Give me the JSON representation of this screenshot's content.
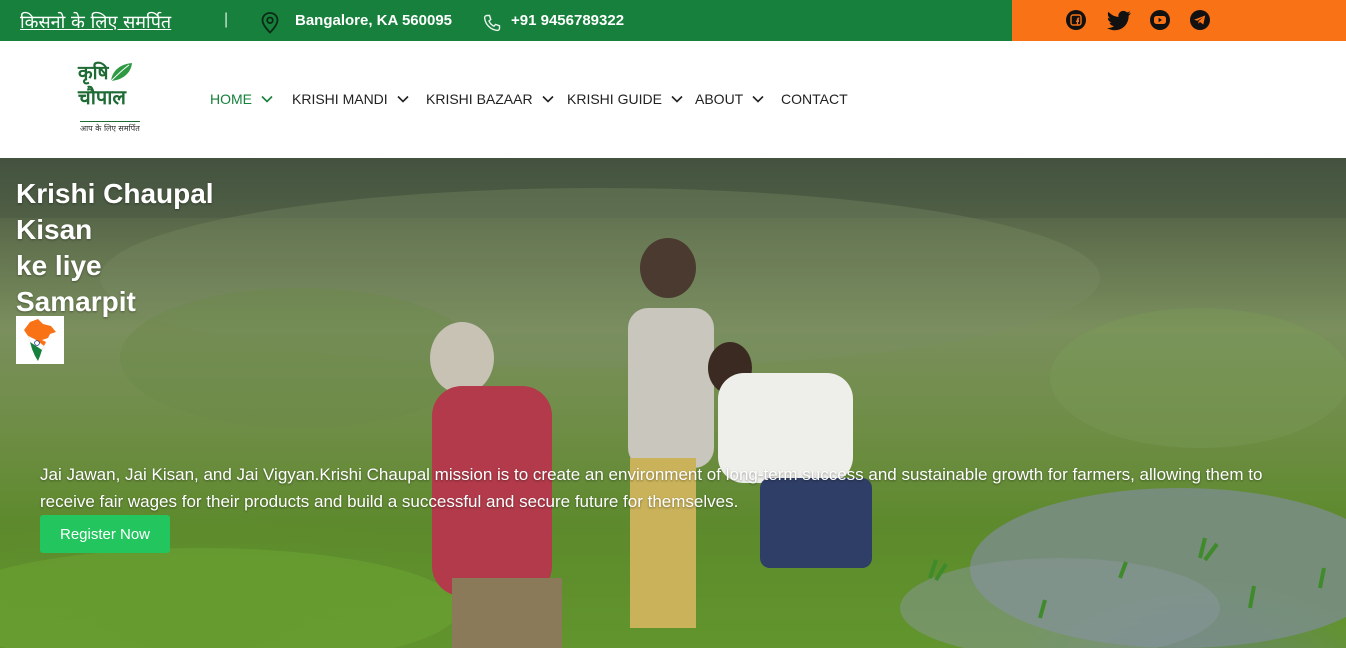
{
  "topbar": {
    "tagline": "किसनो के लिए समर्पित",
    "divider": "|",
    "location": "Bangalore, KA 560095",
    "phone": "+91 9456789322",
    "social_icons": [
      "facebook-icon",
      "twitter-icon",
      "youtube-icon",
      "telegram-icon"
    ],
    "colors": {
      "green": "#16803c",
      "orange": "#f97316"
    }
  },
  "logo": {
    "line1": "कृषि",
    "line2": "चौपाल",
    "subtitle": "आप के लिए समर्पित"
  },
  "nav": {
    "items": [
      {
        "label": "HOME",
        "dropdown": true,
        "active": true
      },
      {
        "label": "KRISHI MANDI",
        "dropdown": true
      },
      {
        "label": "KRISHI BAZAAR",
        "dropdown": true
      },
      {
        "label": "KRISHI GUIDE",
        "dropdown": true
      },
      {
        "label": "ABOUT",
        "dropdown": true
      },
      {
        "label": "CONTACT",
        "dropdown": false
      }
    ]
  },
  "hero": {
    "title_lines": [
      "Krishi Chaupal",
      "Kisan",
      "ke liye",
      "Samarpit"
    ],
    "description": "Jai Jawan, Jai Kisan, and Jai Vigyan.Krishi Chaupal mission is to create an environment of long-term success and sustainable growth for farmers, allowing them to receive fair wages for their products and build a successful and secure future for themselves.",
    "cta_label": "Register Now",
    "cta_color": "#22c55e"
  }
}
